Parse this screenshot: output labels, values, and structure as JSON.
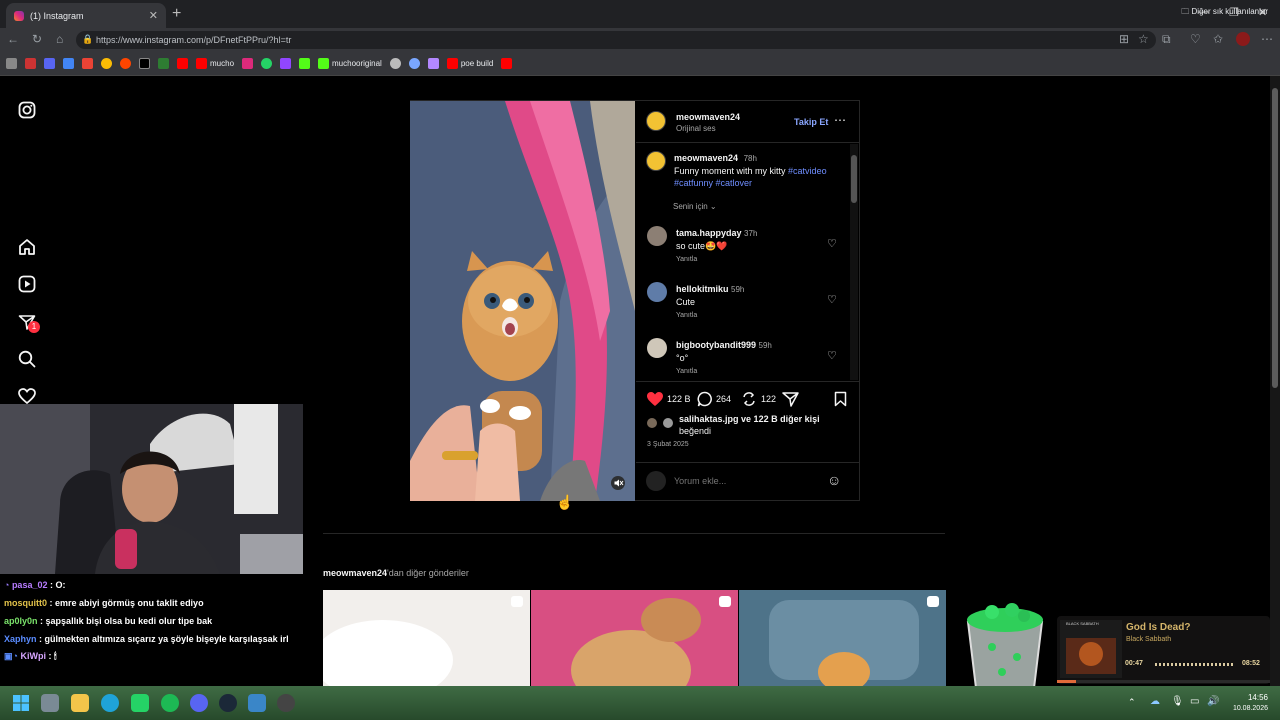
{
  "browser": {
    "tab_title": "(1) Instagram",
    "url": "https://www.instagram.com/p/DFnetFtPPru/?hl=tr",
    "bookmarks": [
      "mucho",
      "muchooriginal",
      "poe build"
    ],
    "other_bookmarks": "Diğer sık kullanılanlar"
  },
  "sidebar": {
    "notification_count": "1"
  },
  "post": {
    "author": "meowmaven24",
    "audio": "Orijinal ses",
    "follow": "Takip Et",
    "caption_author": "meowmaven24",
    "caption_time": "78h",
    "caption_text": "Funny moment with my kitty",
    "caption_tags1": "#catvideo",
    "caption_tags2": "#catfunny #catlover",
    "sort_label": "Senin için",
    "comments": [
      {
        "user": "tama.happyday",
        "time": "37h",
        "text": "so cute🤩❤️",
        "reply": "Yanıtla"
      },
      {
        "user": "hellokitmiku",
        "time": "59h",
        "text": "Cute",
        "reply": "Yanıtla"
      },
      {
        "user": "bigbootybandit999",
        "time": "59h",
        "text": "°o°",
        "reply": "Yanıtla"
      }
    ],
    "likes": "122 B",
    "comments_count": "264",
    "reposts": "122",
    "liked_by_user": "salihaktas.jpg",
    "liked_by_rest": "ve 122 B diğer kişi",
    "liked_by_tail": "beğendi",
    "date": "3 Şubat 2025",
    "comment_placeholder": "Yorum ekle..."
  },
  "more_posts": {
    "user": "meowmaven24",
    "suffix": "'dan diğer gönderiler"
  },
  "chat": [
    {
      "user": "pasa_02",
      "msg": ": O:",
      "color": "#b77cff"
    },
    {
      "user": "mosquitt0",
      "msg": ": emre abiyi görmüş onu taklit ediyo",
      "color": "#e2c24a"
    },
    {
      "user": "ap0ly0n",
      "msg": ": şapşallık bişi olsa bu kedi olur tipe bak",
      "color": "#7be36b"
    },
    {
      "user": "Xaphyn",
      "msg": ": gülmekten altımıza sıçarız ya şöyle bişeyle karşılaşsak irl",
      "color": "#5a8cff"
    },
    {
      "user": "KiWpi",
      "msg": ": 🕯",
      "color": "#d7a6ff"
    }
  ],
  "music": {
    "title": "God Is Dead?",
    "artist": "Black Sabbath",
    "album_text": "BLACK SABBATH",
    "elapsed": "00:47",
    "total": "08:52",
    "progress": 0.09
  },
  "clock": {
    "time": "14:56",
    "date": "10.08.2026"
  }
}
